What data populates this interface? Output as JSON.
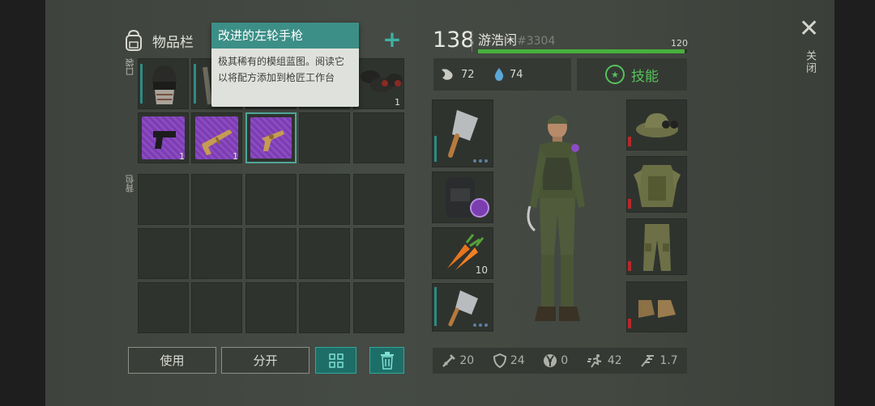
{
  "inventory": {
    "title": "物品栏",
    "pocket_label": "口袋",
    "backpack_label": "背包",
    "slot_counts": {
      "pocket_sacks": "1",
      "pistol_bp": "1",
      "rifle_bp": "1"
    }
  },
  "tooltip": {
    "title": "改进的左轮手枪",
    "description": "极其稀有的模组蓝图。阅读它以将配方添加到枪匠工作台"
  },
  "buttons": {
    "use": "使用",
    "split": "分开"
  },
  "player": {
    "level": "138",
    "name": "游浩闲",
    "tag": "#3304",
    "xp_max": "120",
    "xp_fraction": 0.99,
    "food": "72",
    "water": "74",
    "skill_label": "技能"
  },
  "equipment": {
    "carrot_count": "10"
  },
  "stats": {
    "attack": "20",
    "defense": "24",
    "radiation": "0",
    "speed": "42",
    "weight": "1.7"
  },
  "close_label": "关闭",
  "colors": {
    "accent": "#3fb2a2",
    "xp": "#46b13c",
    "skill": "#55c35a",
    "durability": "#b5292a"
  }
}
